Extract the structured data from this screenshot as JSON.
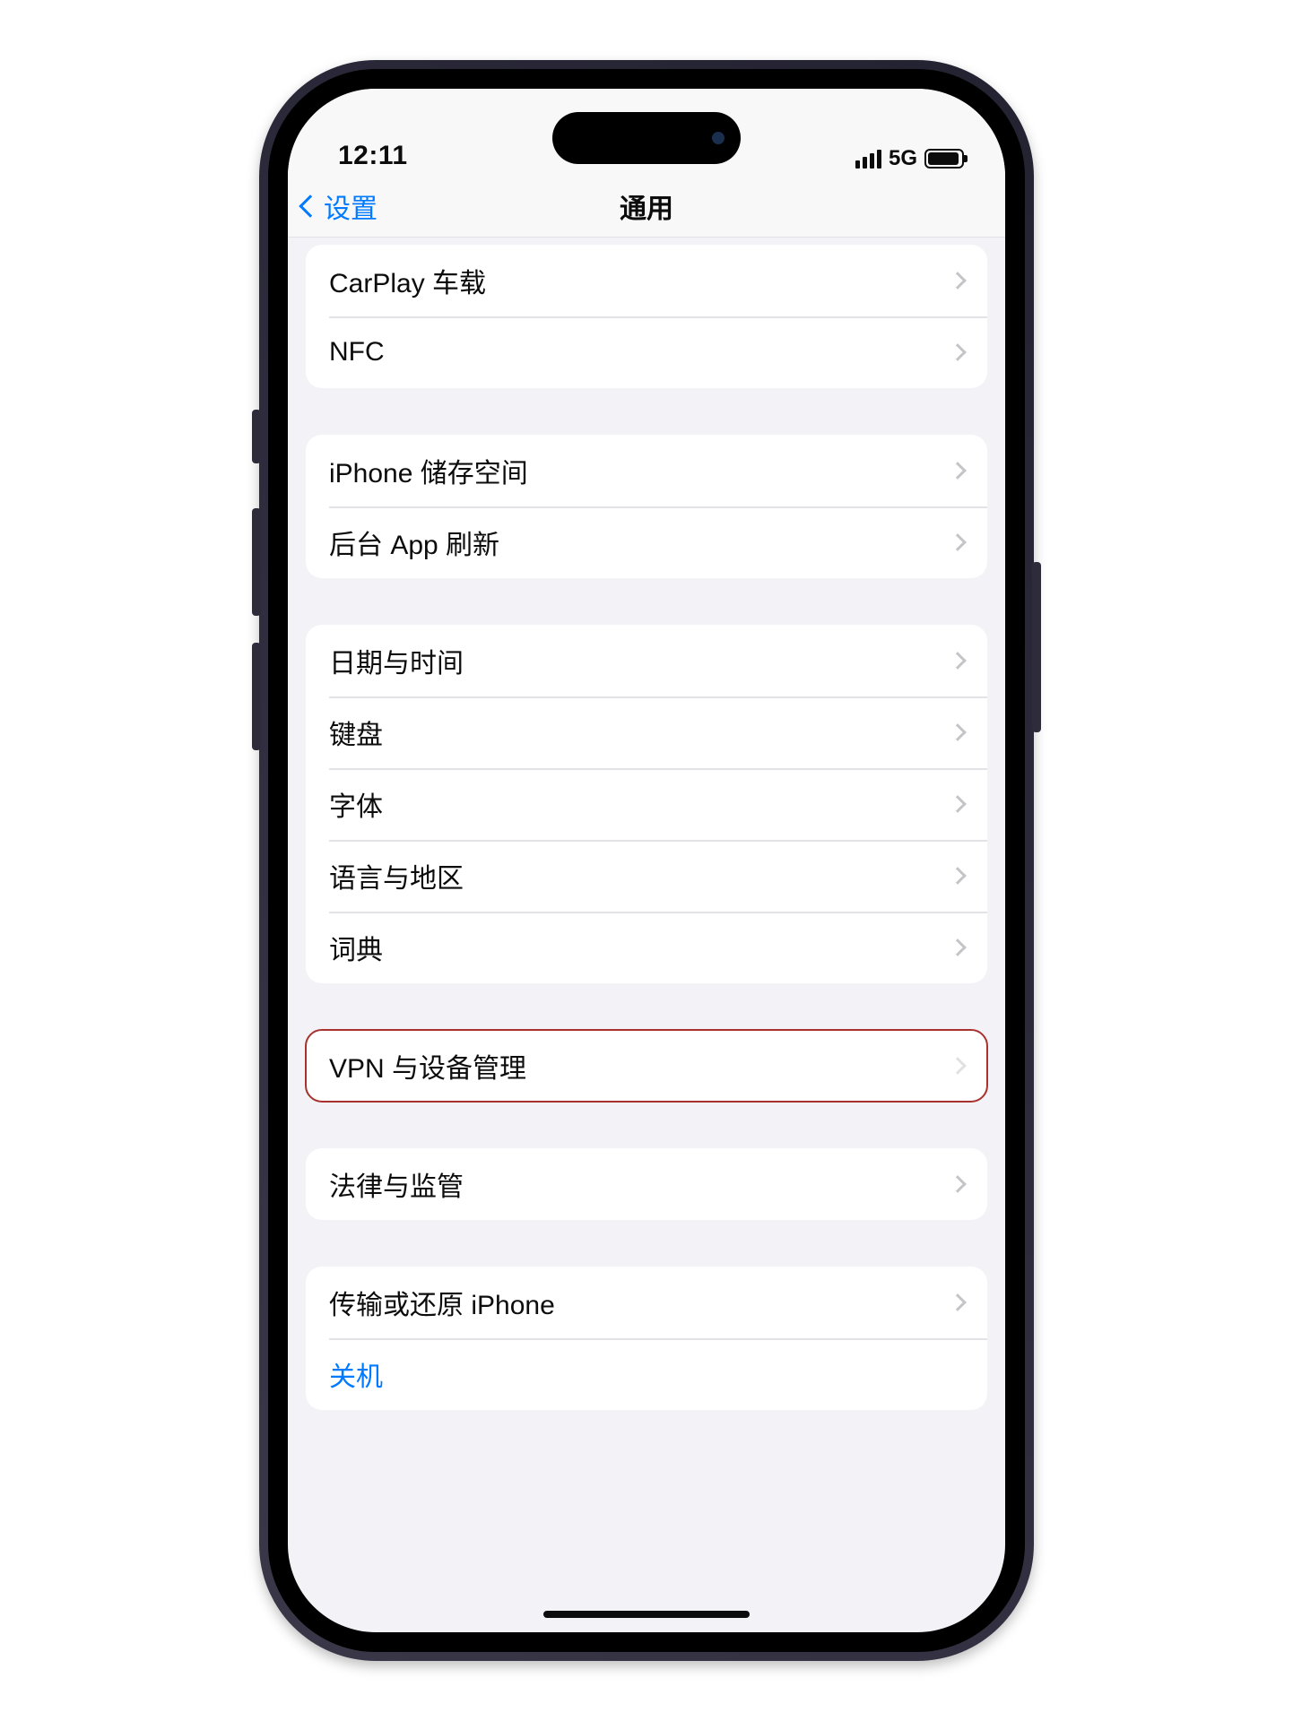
{
  "status": {
    "time": "12:11",
    "network": "5G"
  },
  "nav": {
    "back": "设置",
    "title": "通用"
  },
  "groups": [
    {
      "id": "g1",
      "cells": [
        {
          "id": "carplay",
          "label": "CarPlay 车载",
          "chevron": true
        },
        {
          "id": "nfc",
          "label": "NFC",
          "chevron": true
        }
      ]
    },
    {
      "id": "g2",
      "cells": [
        {
          "id": "storage",
          "label": "iPhone 储存空间",
          "chevron": true
        },
        {
          "id": "bgrefresh",
          "label": "后台 App 刷新",
          "chevron": true
        }
      ]
    },
    {
      "id": "g3",
      "cells": [
        {
          "id": "datetime",
          "label": "日期与时间",
          "chevron": true
        },
        {
          "id": "keyboard",
          "label": "键盘",
          "chevron": true
        },
        {
          "id": "fonts",
          "label": "字体",
          "chevron": true
        },
        {
          "id": "lang",
          "label": "语言与地区",
          "chevron": true
        },
        {
          "id": "dict",
          "label": "词典",
          "chevron": true
        }
      ]
    },
    {
      "id": "g4",
      "highlight": true,
      "cells": [
        {
          "id": "vpn",
          "label": "VPN 与设备管理",
          "chevron": true
        }
      ]
    },
    {
      "id": "g5",
      "cells": [
        {
          "id": "legal",
          "label": "法律与监管",
          "chevron": true
        }
      ]
    },
    {
      "id": "g6",
      "cells": [
        {
          "id": "transfer",
          "label": "传输或还原 iPhone",
          "chevron": true
        },
        {
          "id": "shutdown",
          "label": "关机",
          "chevron": false,
          "link": true
        }
      ]
    }
  ]
}
